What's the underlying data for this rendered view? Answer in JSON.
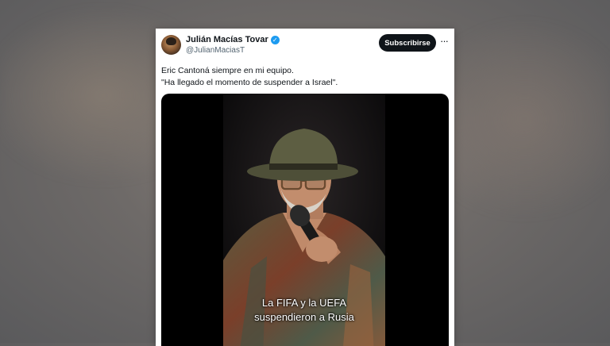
{
  "post": {
    "author": {
      "display_name": "Julián Macías Tovar",
      "handle": "@JulianMaciasT",
      "verified_icon": "verified-badge-icon",
      "verified_glyph": "✓"
    },
    "subscribe_label": "Subscribirse",
    "more_glyph": "···",
    "text_lines": [
      "Eric Cantoná siempre en mi equipo.",
      "\"Ha llegado el momento de suspender a Israel\"."
    ],
    "video": {
      "subtitle_lines": [
        "La FIFA y la UEFA",
        "suspendieron a Rusia"
      ]
    }
  },
  "colors": {
    "accent_verified": "#1d9bf0",
    "button_bg": "#0f1419",
    "text_primary": "#0f1419",
    "text_secondary": "#536471"
  }
}
